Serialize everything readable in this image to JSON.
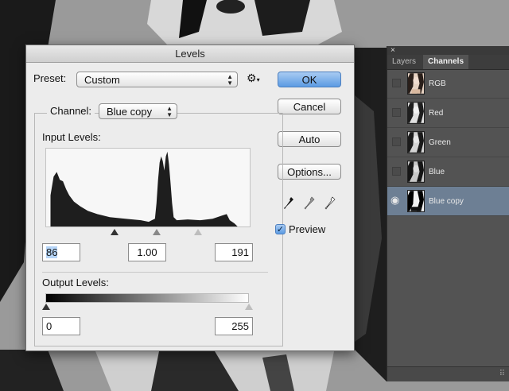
{
  "dialog": {
    "title": "Levels",
    "preset_label": "Preset:",
    "preset_value": "Custom",
    "channel_label": "Channel:",
    "channel_value": "Blue copy",
    "input_levels_label": "Input Levels:",
    "output_levels_label": "Output Levels:",
    "input_black": "86",
    "input_gamma": "1.00",
    "input_white": "191",
    "output_black": "0",
    "output_white": "255",
    "buttons": {
      "ok": "OK",
      "cancel": "Cancel",
      "auto": "Auto",
      "options": "Options..."
    },
    "preview_label": "Preview",
    "preview_checked": true,
    "icons": [
      "gear-icon",
      "black-eyedropper-icon",
      "gray-eyedropper-icon",
      "white-eyedropper-icon"
    ]
  },
  "panel": {
    "close_glyph": "×",
    "tabs": [
      {
        "label": "Layers",
        "active": false
      },
      {
        "label": "Channels",
        "active": true
      }
    ],
    "channels": [
      {
        "label": "RGB",
        "visible": false,
        "selected": false
      },
      {
        "label": "Red",
        "visible": false,
        "selected": false
      },
      {
        "label": "Green",
        "visible": false,
        "selected": false
      },
      {
        "label": "Blue",
        "visible": false,
        "selected": false
      },
      {
        "label": "Blue copy",
        "visible": true,
        "selected": true
      }
    ]
  },
  "colors": {
    "accent": "#5b9be3",
    "selected_row": "#6d7f94",
    "panel_bg": "#535353"
  }
}
